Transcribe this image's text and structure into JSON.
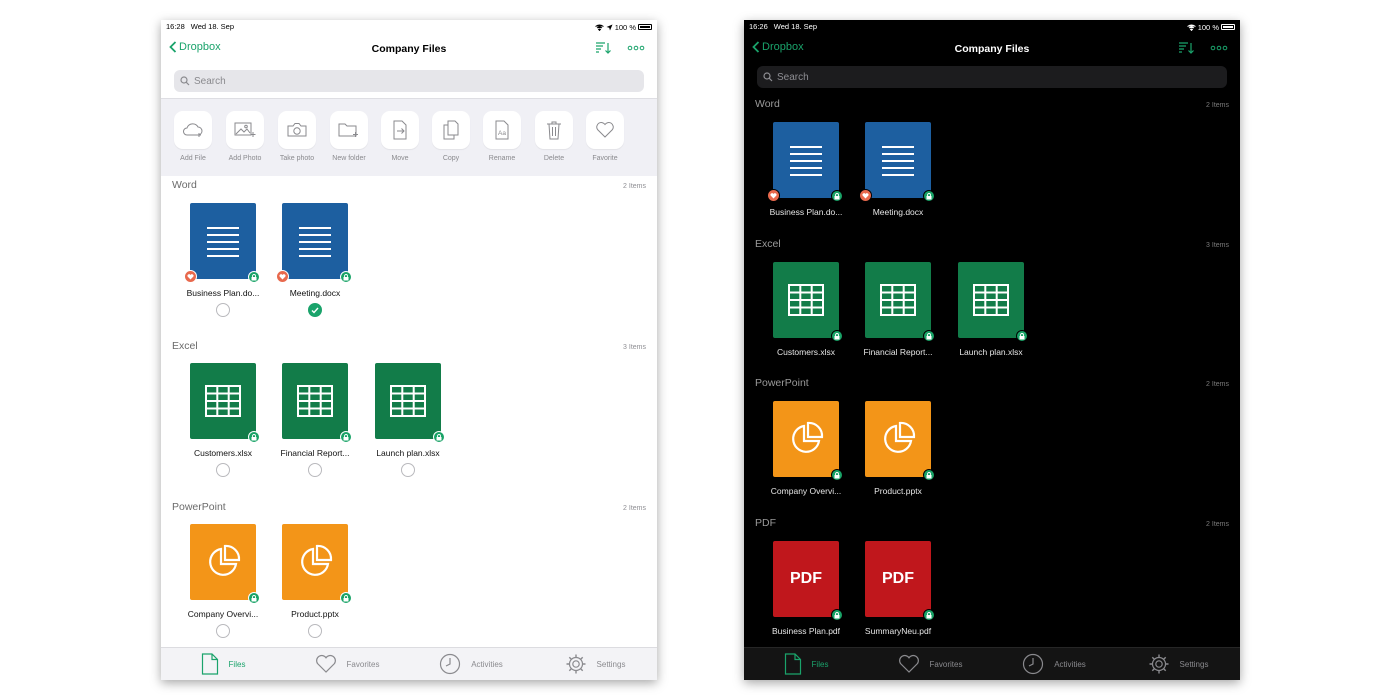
{
  "status": {
    "time": "16:28",
    "date": "Wed 18. Sep",
    "battery": "100 %"
  },
  "status_dark": {
    "time": "16:26",
    "date": "Wed 18. Sep",
    "battery": "100 %"
  },
  "nav": {
    "back_label": "Dropbox",
    "title": "Company Files",
    "sort_icon": "sort-icon",
    "more_icon": "more-icon"
  },
  "search": {
    "placeholder": "Search"
  },
  "actions": [
    {
      "label": "Add File",
      "icon": "cloud-upload-icon"
    },
    {
      "label": "Add Photo",
      "icon": "image-add-icon"
    },
    {
      "label": "Take photo",
      "icon": "camera-icon"
    },
    {
      "label": "New folder",
      "icon": "folder-add-icon"
    },
    {
      "label": "Move",
      "icon": "move-icon"
    },
    {
      "label": "Copy",
      "icon": "copy-icon"
    },
    {
      "label": "Rename",
      "icon": "rename-icon"
    },
    {
      "label": "Delete",
      "icon": "trash-icon"
    },
    {
      "label": "Favorite",
      "icon": "heart-icon"
    }
  ],
  "sections": {
    "word": {
      "title": "Word",
      "count": "2 Items",
      "files": [
        {
          "name": "Business Plan.do...",
          "favorite": true,
          "locked": true,
          "checked": false
        },
        {
          "name": "Meeting.docx",
          "favorite": true,
          "locked": true,
          "checked": true
        }
      ]
    },
    "excel": {
      "title": "Excel",
      "count": "3 Items",
      "files": [
        {
          "name": "Customers.xlsx",
          "locked": true,
          "checked": false
        },
        {
          "name": "Financial Report...",
          "locked": true,
          "checked": false
        },
        {
          "name": "Launch plan.xlsx",
          "locked": true,
          "checked": false
        }
      ]
    },
    "powerpoint": {
      "title": "PowerPoint",
      "count": "2 Items",
      "files": [
        {
          "name": "Company Overvi...",
          "locked": true,
          "checked": false
        },
        {
          "name": "Product.pptx",
          "locked": true,
          "checked": false
        }
      ]
    },
    "pdf": {
      "title": "PDF",
      "count": "2 Items",
      "badge_text": "PDF",
      "files": [
        {
          "name": "Business Plan.pdf",
          "locked": true
        },
        {
          "name": "SummaryNeu.pdf",
          "locked": true
        }
      ]
    }
  },
  "tabs": [
    {
      "label": "Files",
      "icon": "file-icon",
      "active": true
    },
    {
      "label": "Favorites",
      "icon": "heart-icon",
      "active": false
    },
    {
      "label": "Activities",
      "icon": "clock-icon",
      "active": false
    },
    {
      "label": "Settings",
      "icon": "gear-icon",
      "active": false
    }
  ],
  "colors": {
    "accent": "#1aa36b",
    "word": "#1d5fa0",
    "excel": "#127c49",
    "powerpoint": "#f39518",
    "pdf": "#c0171c",
    "favorite": "#e8694d"
  }
}
